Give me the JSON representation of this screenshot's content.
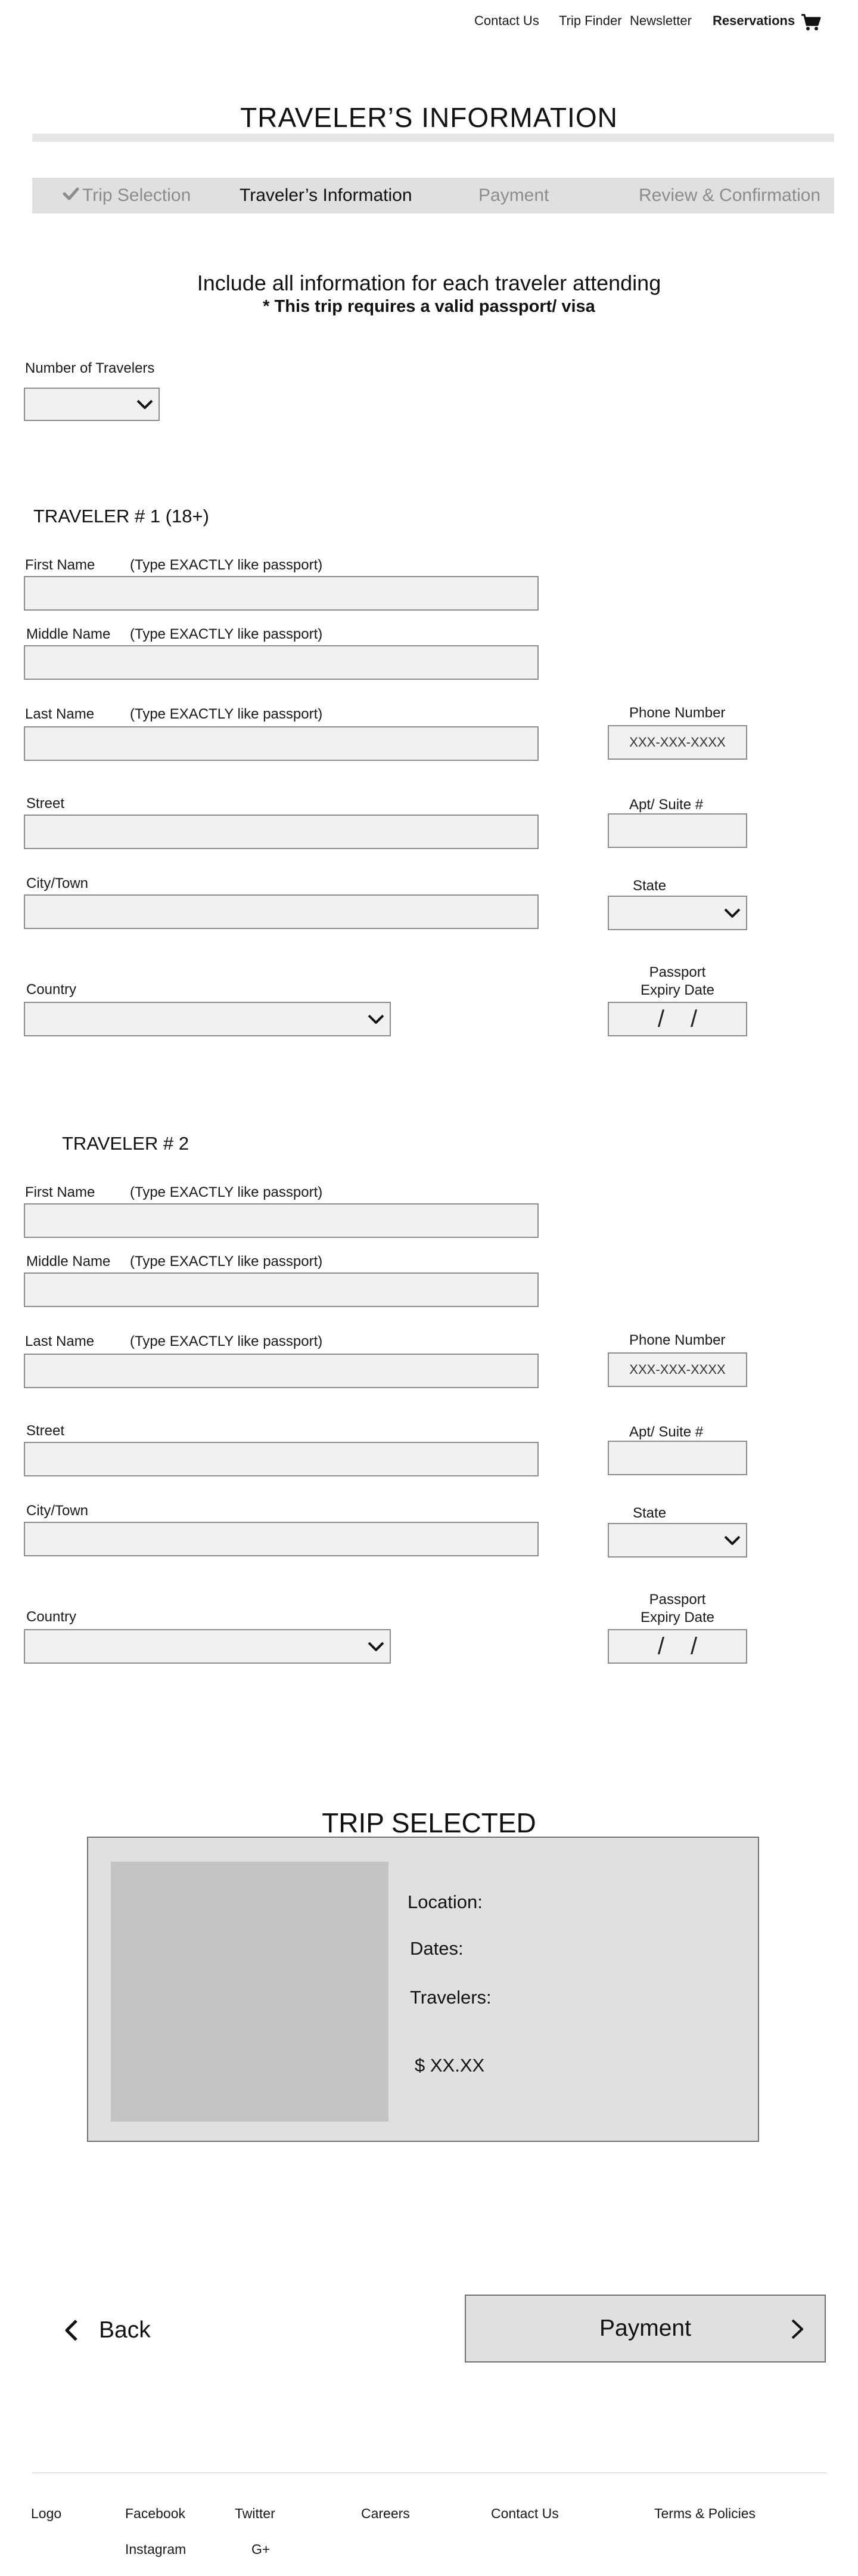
{
  "nav": {
    "contact": "Contact Us",
    "trip_finder": "Trip Finder",
    "newsletter": "Newsletter",
    "reservations": "Reservations",
    "cart_icon": "shopping-cart"
  },
  "page_title": "TRAVELER’S INFORMATION",
  "stepper": {
    "steps": [
      {
        "label": "Trip Selection",
        "state": "completed"
      },
      {
        "label": "Traveler’s Information",
        "state": "current"
      },
      {
        "label": "Payment",
        "state": "upcoming"
      },
      {
        "label": "Review & Confirmation",
        "state": "upcoming"
      }
    ]
  },
  "intro": {
    "line1": "Include all information for each traveler attending",
    "line2": "* This trip requires a valid passport/ visa"
  },
  "num_travelers": {
    "label": "Number of Travelers",
    "value": ""
  },
  "travelers": [
    {
      "heading": "TRAVELER # 1   (18+)",
      "first_name_label": "First Name",
      "middle_name_label": "Middle Name",
      "last_name_label": "Last Name",
      "passport_hint": "(Type EXACTLY like passport)",
      "street_label": "Street",
      "city_label": "City/Town",
      "country_label": "Country",
      "phone_label": "Phone Number",
      "phone_placeholder": "XXX-XXX-XXXX",
      "apt_label": "Apt/ Suite #",
      "state_label": "State",
      "passport_expiry_label_1": "Passport",
      "passport_expiry_label_2": "Expiry Date",
      "expiry_separator": "/"
    },
    {
      "heading": "TRAVELER # 2",
      "first_name_label": "First Name",
      "middle_name_label": "Middle Name",
      "last_name_label": "Last Name",
      "passport_hint": "(Type EXACTLY like passport)",
      "street_label": "Street",
      "city_label": "City/Town",
      "country_label": "Country",
      "phone_label": "Phone Number",
      "phone_placeholder": "XXX-XXX-XXXX",
      "apt_label": "Apt/ Suite #",
      "state_label": "State",
      "passport_expiry_label_1": "Passport",
      "passport_expiry_label_2": "Expiry Date",
      "expiry_separator": "/"
    }
  ],
  "trip": {
    "title": "TRIP SELECTED",
    "location_label": "Location:",
    "dates_label": "Dates:",
    "travelers_label": "Travelers:",
    "price": "$ XX.XX"
  },
  "actions": {
    "back": "Back",
    "payment": "Payment"
  },
  "footer": {
    "logo": "Logo",
    "facebook": "Facebook",
    "instagram": "Instagram",
    "twitter": "Twitter",
    "gplus": "G+",
    "careers": "Careers",
    "contact": "Contact Us",
    "terms": "Terms & Policies"
  },
  "colors": {
    "panel": "#e0e0e0",
    "field_bg": "#f1f1f1",
    "field_border": "#8c8c8c",
    "step_inactive": "#8c8c8c",
    "image_placeholder": "#c4c4c4"
  }
}
